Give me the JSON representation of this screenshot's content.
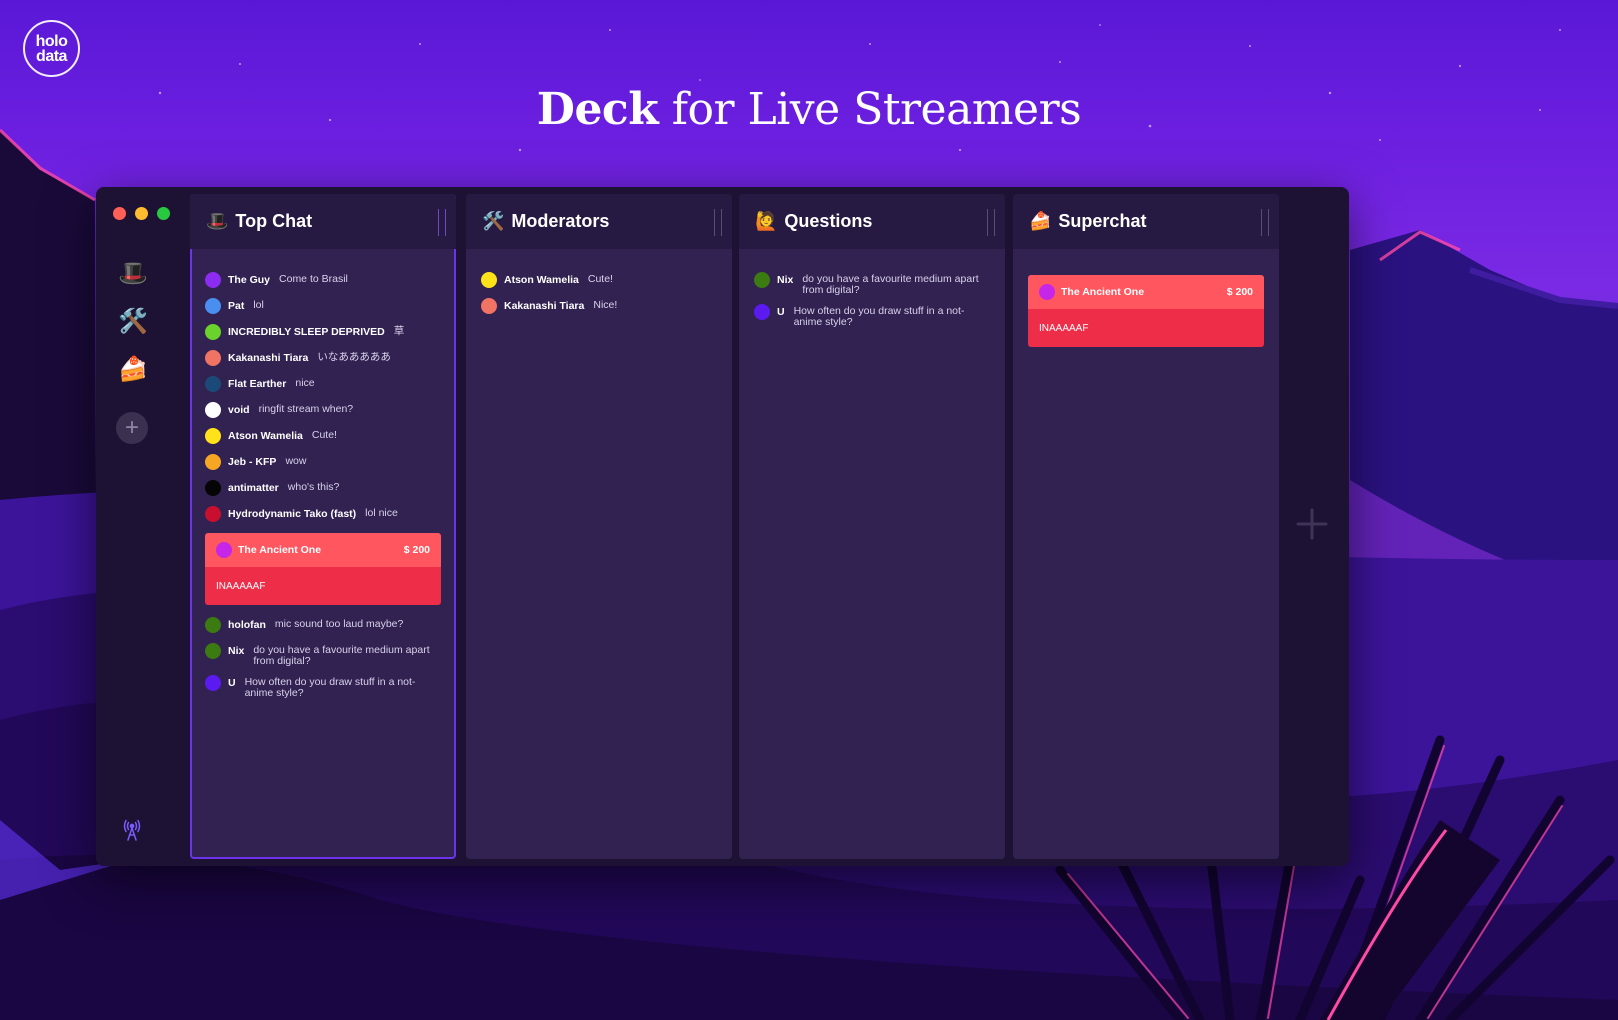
{
  "brand": {
    "logo_line1": "holo",
    "logo_line2": "data"
  },
  "headline": {
    "strong": "Deck",
    "rest": "for Live Streamers"
  },
  "colors": {
    "accent": "#6b34ea",
    "superchat_top": "#ff5660",
    "superchat_bottom": "#ee2e49",
    "window_bg": "#1d1233",
    "column_bg": "#312252",
    "column_header_bg": "#261a42"
  },
  "rail": {
    "items": [
      {
        "icon": "top-hat-icon",
        "glyph": "🎩"
      },
      {
        "icon": "hammer-wrench-icon",
        "glyph": "🛠️"
      },
      {
        "icon": "cake-icon",
        "glyph": "🍰"
      }
    ],
    "add_glyph": "+",
    "add_icon": "plus-icon",
    "footer_icon": "broadcast-tower-icon"
  },
  "columns": [
    {
      "emoji": "🎩",
      "title": "Top Chat",
      "active": true,
      "messages": [
        {
          "author": "The Guy",
          "text": "Come to Brasil",
          "avatar_color": "#8b2cf0"
        },
        {
          "author": "Pat",
          "text": "lol",
          "avatar_color": "#4a8ff0"
        },
        {
          "author": "INCREDIBLY SLEEP DEPRIVED",
          "text": "草",
          "avatar_color": "#6ad22a"
        },
        {
          "author": "Kakanashi Tiara",
          "text": "いなあああああ",
          "avatar_color": "#f07363"
        },
        {
          "author": "Flat Earther",
          "text": "nice",
          "avatar_color": "#1c4a78"
        },
        {
          "author": "void",
          "text": "ringfit stream when?",
          "avatar_color": "#ffffff"
        },
        {
          "author": "Atson Wamelia",
          "text": "Cute!",
          "avatar_color": "#ffe21a"
        },
        {
          "author": "Jeb - KFP",
          "text": "wow",
          "avatar_color": "#f5a623"
        },
        {
          "author": "antimatter",
          "text": "who's this?",
          "avatar_color": "#050505"
        },
        {
          "author": "Hydrodynamic Tako (fast)",
          "text": "lol nice",
          "avatar_color": "#c8102e"
        },
        {
          "superchat": true,
          "author": "The Ancient One",
          "amount": "$ 200",
          "text": "INAAAAAF",
          "avatar_color": "#c626e8"
        },
        {
          "author": "holofan",
          "text": "mic sound too laud maybe?",
          "avatar_color": "#3c7a12"
        },
        {
          "author": "Nix",
          "text": "do you have a favourite medium apart from digital?",
          "avatar_color": "#3c7a12"
        },
        {
          "author": "U",
          "text": "How often do you draw stuff in a not-anime style?",
          "avatar_color": "#5a1af0"
        }
      ]
    },
    {
      "emoji": "🛠️",
      "title": "Moderators",
      "active": false,
      "messages": [
        {
          "author": "Atson Wamelia",
          "text": "Cute!",
          "avatar_color": "#ffe21a"
        },
        {
          "author": "Kakanashi Tiara",
          "text": "Nice!",
          "avatar_color": "#f07363"
        }
      ]
    },
    {
      "emoji": "🙋",
      "title": "Questions",
      "active": false,
      "messages": [
        {
          "author": "Nix",
          "text": "do you have a favourite medium apart from digital?",
          "avatar_color": "#3c7a12"
        },
        {
          "author": "U",
          "text": "How often do you draw stuff in a not-anime style?",
          "avatar_color": "#5a1af0"
        }
      ]
    },
    {
      "emoji": "🍰",
      "title": "Superchat",
      "active": false,
      "messages": [
        {
          "superchat": true,
          "author": "The Ancient One",
          "amount": "$ 200",
          "text": "INAAAAAF",
          "avatar_color": "#c626e8"
        }
      ]
    }
  ],
  "add_column": {
    "icon": "plus-icon",
    "glyph": "+"
  }
}
